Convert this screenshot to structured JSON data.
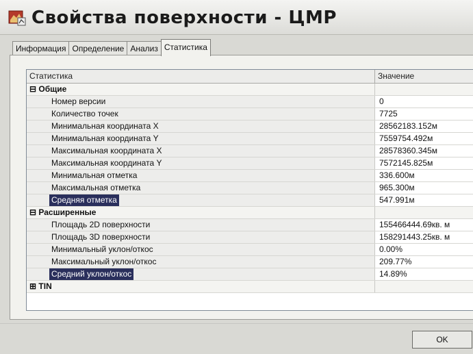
{
  "window": {
    "title": "Свойства поверхности - ЦМР"
  },
  "tabs": [
    {
      "label": "Информация",
      "active": false
    },
    {
      "label": "Определение",
      "active": false
    },
    {
      "label": "Анализ",
      "active": false
    },
    {
      "label": "Статистика",
      "active": true
    }
  ],
  "table": {
    "headers": {
      "name": "Статистика",
      "value": "Значение"
    },
    "groups": [
      {
        "label": "Общие",
        "expander": "⊟",
        "rows": [
          {
            "name": "Номер версии",
            "value": "0"
          },
          {
            "name": "Количество точек",
            "value": "7725"
          },
          {
            "name": "Минимальная координата X",
            "value": "28562183.152м"
          },
          {
            "name": "Минимальная координата Y",
            "value": "7559754.492м"
          },
          {
            "name": "Максимальная координата X",
            "value": "28578360.345м"
          },
          {
            "name": "Максимальная координата Y",
            "value": "7572145.825м"
          },
          {
            "name": "Минимальная отметка",
            "value": "336.600м"
          },
          {
            "name": "Максимальная отметка",
            "value": "965.300м"
          },
          {
            "name": "Средняя отметка",
            "value": "547.991м",
            "selected": true
          }
        ]
      },
      {
        "label": "Расширенные",
        "expander": "⊟",
        "rows": [
          {
            "name": "Площадь 2D поверхности",
            "value": "155466444.69кв. м"
          },
          {
            "name": "Площадь 3D поверхности",
            "value": "158291443.25кв. м"
          },
          {
            "name": "Минимальный уклон/откос",
            "value": "0.00%"
          },
          {
            "name": "Максимальный уклон/откос",
            "value": "209.77%"
          },
          {
            "name": "Средний уклон/откос",
            "value": "14.89%",
            "selected": true
          }
        ]
      },
      {
        "label": "TIN",
        "expander": "⊞",
        "rows": []
      }
    ]
  },
  "buttons": {
    "ok": "OK"
  },
  "colors": {
    "selection": "#2a2f5c",
    "window_bg": "#d9d9d4"
  }
}
